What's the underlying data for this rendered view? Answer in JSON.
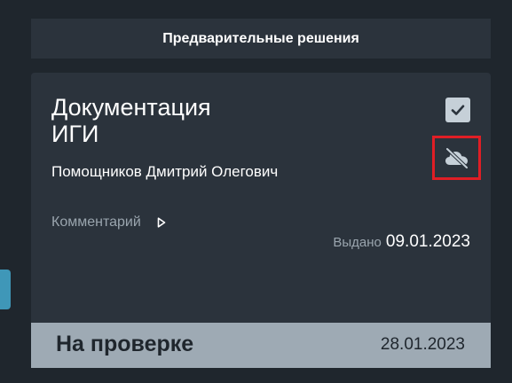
{
  "section": {
    "title": "Предварительные решения"
  },
  "card": {
    "title_line1": "Документация",
    "title_line2": "ИГИ",
    "person": "Помощников Дмитрий Олегович",
    "checkbox_checked": true,
    "comment_label": "Комментарий",
    "issued_label": "Выдано",
    "issued_date": "09.01.2023",
    "icons": {
      "checkbox": "check-icon",
      "cloud": "cloud-off-icon",
      "comment_toggle": "play-arrow-icon"
    }
  },
  "status": {
    "label": "На проверке",
    "date": "28.01.2023"
  },
  "colors": {
    "background": "#1f262d",
    "panel": "#2b333c",
    "status_bar": "#9eaab4",
    "highlight": "#e01e25",
    "left_tab": "#3f97b8"
  }
}
